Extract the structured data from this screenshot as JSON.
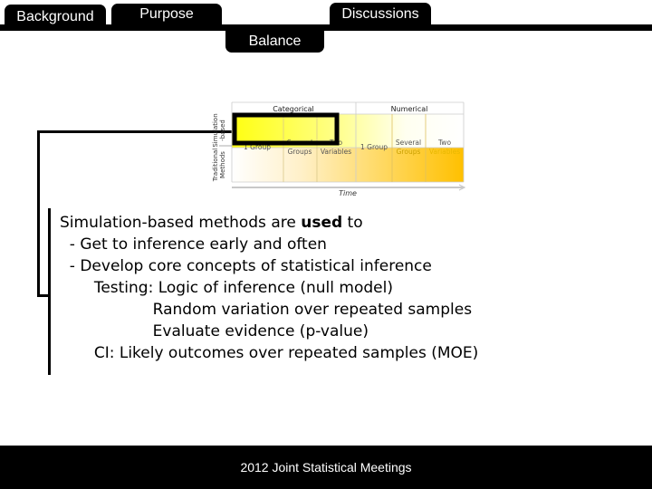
{
  "nav": {
    "tabs": [
      {
        "label": "Background"
      },
      {
        "label": "Purpose"
      },
      {
        "label": "Balance",
        "active": true
      },
      {
        "label": "Discussions"
      }
    ]
  },
  "figure": {
    "column_groups": [
      "Categorical",
      "Numerical"
    ],
    "row_labels": [
      "Simulation -based",
      "Traditional Methods"
    ],
    "columns": [
      {
        "group": "Categorical",
        "label_line1": "1 Group",
        "label_line2": ""
      },
      {
        "group": "Categorical",
        "label_line1": "Several",
        "label_line2": "Groups"
      },
      {
        "group": "Categorical",
        "label_line1": "Two",
        "label_line2": "Variables"
      },
      {
        "group": "Numerical",
        "label_line1": "1 Group",
        "label_line2": ""
      },
      {
        "group": "Numerical",
        "label_line1": "Several",
        "label_line2": "Groups"
      },
      {
        "group": "Numerical",
        "label_line1": "Two",
        "label_line2": "Variables"
      }
    ],
    "axis_label": "Time",
    "highlight": "Simulation-based, Categorical",
    "colors": {
      "simulation_fill": "#ffff00",
      "traditional_fill": "#ffc000",
      "highlight_border": "#000000"
    }
  },
  "content": {
    "intro_prefix": "Simulation-based methods are ",
    "intro_bold": "used",
    "intro_suffix": " to",
    "lines": [
      "  - Get to inference early and often",
      "  - Develop core concepts of statistical inference",
      "       Testing: Logic of inference (null model)",
      "                   Random variation over repeated samples",
      "                   Evaluate evidence (p-value)",
      "       CI: Likely outcomes over repeated samples (MOE)"
    ]
  },
  "footer": {
    "text": "2012 Joint Statistical Meetings"
  }
}
